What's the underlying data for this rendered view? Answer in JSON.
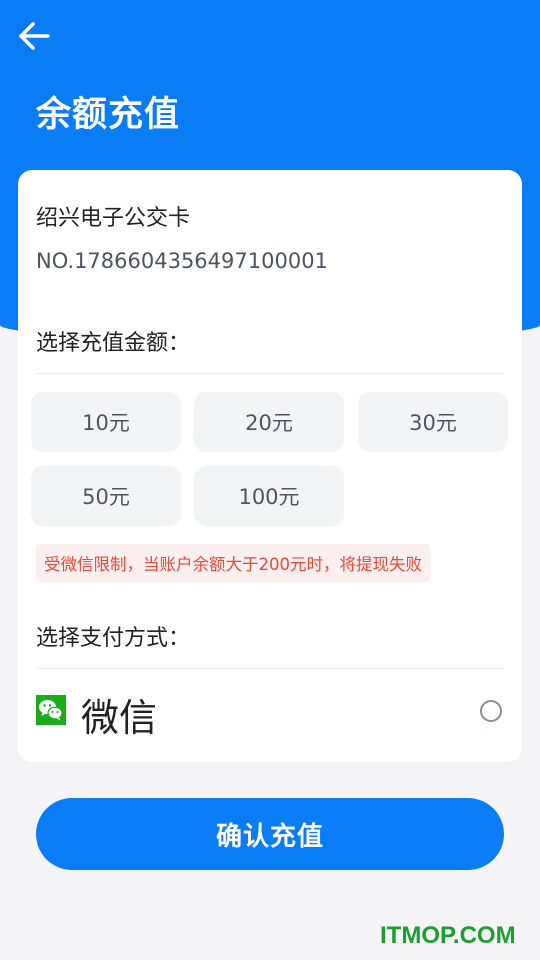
{
  "header": {
    "back_icon": "arrow-left-icon",
    "title": "余额充值"
  },
  "card": {
    "name": "绍兴电子公交卡",
    "number": "NO.1786604356497100001"
  },
  "amount_section": {
    "label": "选择充值金额：",
    "options": [
      "10元",
      "20元",
      "30元",
      "50元",
      "100元"
    ]
  },
  "notice": "受微信限制，当账户余额大于200元时，将提现失败",
  "payment_section": {
    "label": "选择支付方式：",
    "methods": [
      {
        "name": "微信",
        "icon": "wechat-icon",
        "selected": false
      }
    ]
  },
  "confirm_button": "确认充值",
  "watermark": "ITMOP.COM",
  "colors": {
    "primary": "#0a7cf5",
    "notice_text": "#e84a3a",
    "notice_bg": "#fcefef",
    "wechat": "#1aad19",
    "watermark": "#1d9e32"
  }
}
